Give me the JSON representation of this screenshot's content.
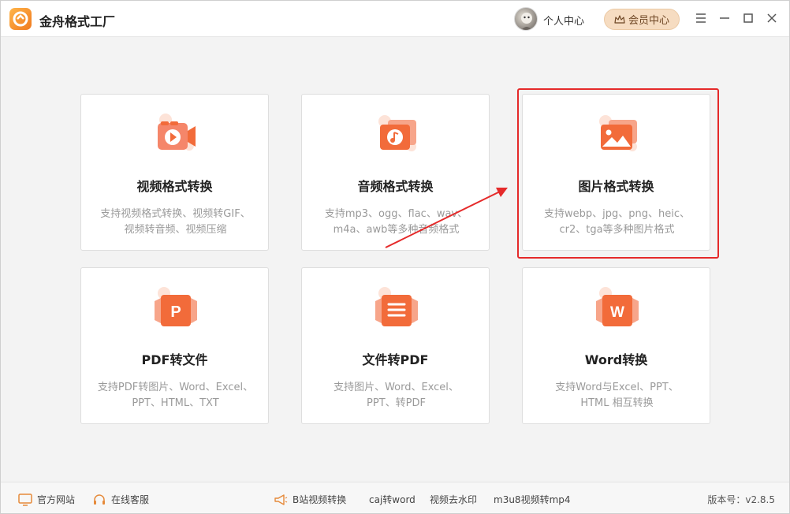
{
  "app": {
    "title": "金舟格式工厂",
    "personal_center": "个人中心",
    "vip_center": "会员中心"
  },
  "cards": [
    {
      "title": "视频格式转换",
      "desc1": "支持视频格式转换、视频转GIF、",
      "desc2": "视频转音频、视频压缩",
      "icon": "video-icon"
    },
    {
      "title": "音频格式转换",
      "desc1": "支持mp3、ogg、flac、wav、",
      "desc2": "m4a、awb等多种音频格式",
      "icon": "audio-icon"
    },
    {
      "title": "图片格式转换",
      "desc1": "支持webp、jpg、png、heic、",
      "desc2": "cr2、tga等多种图片格式",
      "icon": "image-icon"
    },
    {
      "title": "PDF转文件",
      "desc1": "支持PDF转图片、Word、Excel、",
      "desc2": "PPT、HTML、TXT",
      "icon": "pdf-p-icon"
    },
    {
      "title": "文件转PDF",
      "desc1": "支持图片、Word、Excel、",
      "desc2": "PPT、转PDF",
      "icon": "document-icon"
    },
    {
      "title": "Word转换",
      "desc1": "支持Word与Excel、PPT、",
      "desc2": "HTML 相互转换",
      "icon": "word-w-icon"
    }
  ],
  "footer": {
    "official_site": "官方网站",
    "online_service": "在线客服",
    "links": [
      "B站视频转换",
      "caj转word",
      "视频去水印",
      "m3u8视频转mp4"
    ],
    "version": "版本号：v2.8.5"
  },
  "colors": {
    "accent": "#f26b3a",
    "highlight": "#e52a2a",
    "vip_bg": "#f6dcc1"
  }
}
